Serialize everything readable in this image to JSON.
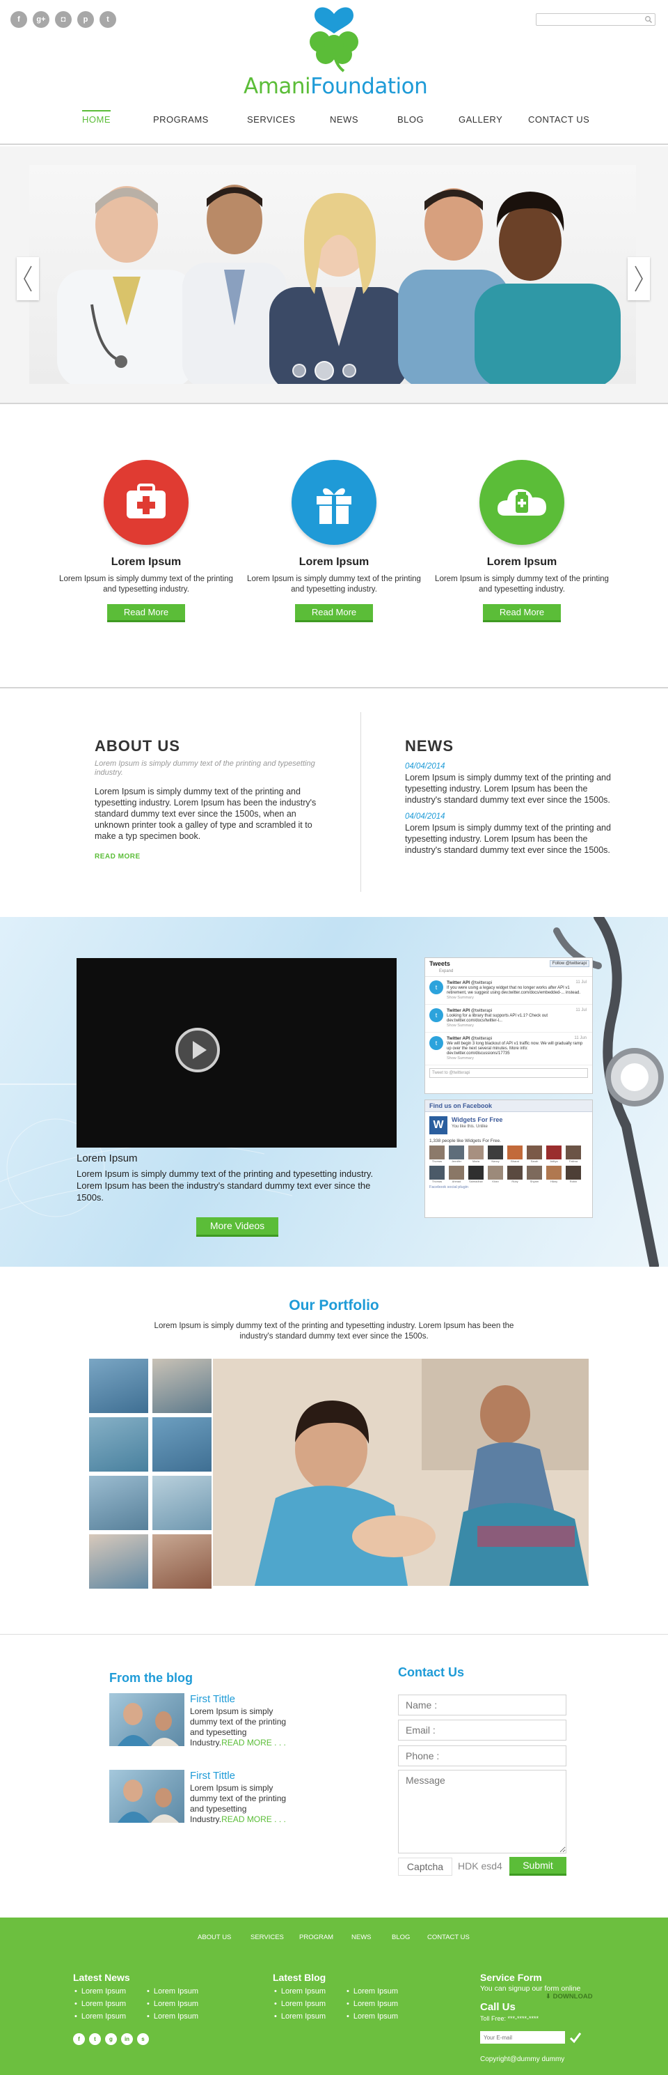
{
  "header": {
    "socials": [
      {
        "icon": "facebook-icon",
        "glyph": "f"
      },
      {
        "icon": "google-plus-icon",
        "glyph": "g+"
      },
      {
        "icon": "instagram-icon",
        "glyph": "◘"
      },
      {
        "icon": "pinterest-icon",
        "glyph": "p"
      },
      {
        "icon": "twitter-icon",
        "glyph": "t"
      }
    ],
    "search_placeholder": "",
    "logo_part1": "Amani",
    "logo_part2": "Foundation",
    "nav": [
      "HOME",
      "PROGRAMS",
      "SERVICES",
      "NEWS",
      "BLOG",
      "GALLERY",
      "CONTACT US"
    ]
  },
  "slider": {
    "prev_glyph": "‹",
    "next_glyph": "›"
  },
  "features": [
    {
      "title": "Lorem Ipsum",
      "text": "Lorem Ipsum is simply dummy text of the printing and typesetting industry.",
      "button": "Read More",
      "icon": "first-aid-kit-icon",
      "color": "#e03b32"
    },
    {
      "title": "Lorem Ipsum",
      "text": "Lorem Ipsum is simply dummy text of the printing and typesetting industry.",
      "button": "Read More",
      "icon": "gift-box-icon",
      "color": "#1f9ad7"
    },
    {
      "title": "Lorem Ipsum",
      "text": "Lorem Ipsum is simply dummy text of the printing and typesetting industry.",
      "button": "Read More",
      "icon": "medicine-cloud-icon",
      "color": "#5bbd38"
    }
  ],
  "about": {
    "title": "ABOUT US",
    "subtitle": "Lorem Ipsum is simply dummy text of the printing and typesetting industry.",
    "body": "Lorem Ipsum is simply dummy text of the printing and typesetting industry. Lorem Ipsum has been the industry's standard dummy text ever since the 1500s, when an unknown printer took a galley of type and scrambled it to make a typ specimen book.",
    "read_more": "READ MORE"
  },
  "news": {
    "title": "NEWS",
    "items": [
      {
        "date": "04/04/2014",
        "text": "Lorem Ipsum is simply dummy text of the printing and typesetting industry. Lorem Ipsum has been the industry's standard dummy text ever since the 1500s."
      },
      {
        "date": "04/04/2014",
        "text": "Lorem Ipsum is simply dummy text of the printing and typesetting industry. Lorem Ipsum has been the industry's standard dummy text ever since the 1500s."
      }
    ]
  },
  "video": {
    "title": "Lorem Ipsum",
    "text": "Lorem Ipsum is simply dummy text of the printing and typesetting industry. Lorem Ipsum has been the industry's standard dummy text ever since the 1500s.",
    "button": "More Videos"
  },
  "twitter": {
    "title": "Tweets",
    "follow": "Follow @twitterapi",
    "expand": "Expand",
    "tweets": [
      {
        "name": "Twitter API",
        "handle": "@twitterapi",
        "time": "11 Jul",
        "text": "If you were using a legacy widget that no longer works after API v1 retirement, we suggest using dev.twitter.com/docs/embedded-... instead.",
        "summary": "Show Summary"
      },
      {
        "name": "Twitter API",
        "handle": "@twitterapi",
        "time": "11 Jul",
        "text": "Looking for a library that supports API v1.1? Check out dev.twitter.com/docs/twitter-l...",
        "summary": "Show Summary"
      },
      {
        "name": "Twitter API",
        "handle": "@twitterapi",
        "time": "11 Jun",
        "text": "We will begin 3 long blackout of API v1 traffic now. We will gradually ramp up over the next several minutes. More info: dev.twitter.com/discussions/17735",
        "summary": "Show Summary"
      }
    ],
    "input_placeholder": "Tweet to @twitterapi"
  },
  "facebook": {
    "title": "Find us on Facebook",
    "page_name": "Widgets For Free",
    "like": "You like this. Unlike",
    "count": "1,338 people like Widgets For Free.",
    "faces": [
      "Thomas",
      "Jennifer",
      "Maria",
      "Nancy",
      "Bharat",
      "Sarah",
      "Aditya",
      "Fatima",
      "Thomas",
      "Ahmad",
      "Saimadhav",
      "Kiran",
      "Ruby",
      "Shyam",
      "Hilary",
      "Robin"
    ],
    "plugin": "Facebook social plugin"
  },
  "portfolio": {
    "title": "Our Portfolio",
    "text": "Lorem Ipsum is simply dummy text of the printing and typesetting industry. Lorem Ipsum has been the industry's standard dummy text ever since the 1500s."
  },
  "blog": {
    "title": "From the blog",
    "posts": [
      {
        "title": "First Tittle",
        "text": "Lorem Ipsum is simply dummy text of the printing and typesetting Industry.",
        "more": "READ MORE . . ."
      },
      {
        "title": "First Tittle",
        "text": "Lorem Ipsum is simply dummy text of the printing and typesetting Industry.",
        "more": "READ MORE . . ."
      }
    ]
  },
  "contact": {
    "title": "Contact Us",
    "name_placeholder": "Name :",
    "email_placeholder": "Email :",
    "phone_placeholder": "Phone :",
    "message_placeholder": "Message",
    "captcha_label": "Captcha",
    "captcha_code": "HDK esd4",
    "submit": "Submit"
  },
  "footer": {
    "nav": [
      "ABOUT US",
      "SERVICES",
      "PROGRAM",
      "NEWS",
      "BLOG",
      "CONTACT US"
    ],
    "latest_news_title": "Latest News",
    "latest_news": [
      "Lorem Ipsum",
      "Lorem Ipsum",
      "Lorem Ipsum",
      "Lorem Ipsum",
      "Lorem Ipsum",
      "Lorem Ipsum"
    ],
    "latest_blog_title": "Latest Blog",
    "latest_blog": [
      "Lorem Ipsum",
      "Lorem Ipsum",
      "Lorem Ipsum",
      "Lorem Ipsum",
      "Lorem Ipsum",
      "Lorem Ipsum"
    ],
    "service_title": "Service Form",
    "service_text": "You can signup our form online",
    "download": "⬇ DOWNLOAD",
    "call_title": "Call Us",
    "toll_free": "Toll Free: ***-****-****",
    "email_placeholder": "Your E-mail",
    "copyright": "Copyright@dummy dummy",
    "socials": [
      {
        "icon": "facebook-icon",
        "glyph": "f"
      },
      {
        "icon": "twitter-icon",
        "glyph": "t"
      },
      {
        "icon": "google-plus-icon",
        "glyph": "g"
      },
      {
        "icon": "linkedin-icon",
        "glyph": "in"
      },
      {
        "icon": "skype-icon",
        "glyph": "s"
      }
    ]
  }
}
